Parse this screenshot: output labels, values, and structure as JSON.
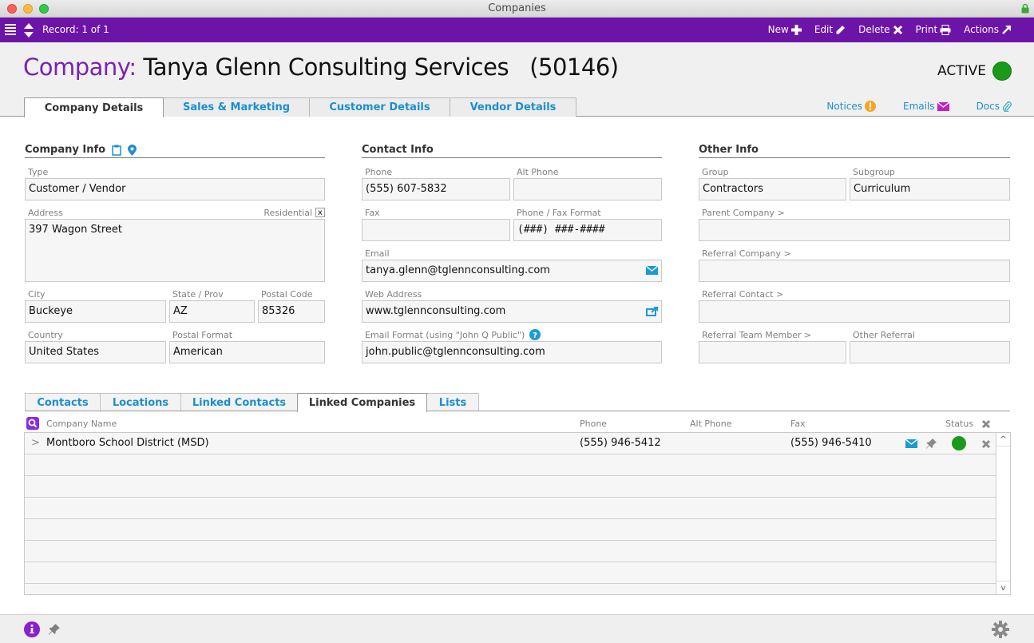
{
  "window": {
    "title": "Companies"
  },
  "toolbar": {
    "record": "Record: 1 of 1",
    "buttons": [
      {
        "label": "New",
        "icon": "plus-icon"
      },
      {
        "label": "Edit",
        "icon": "pencil-icon"
      },
      {
        "label": "Delete",
        "icon": "x-icon"
      },
      {
        "label": "Print",
        "icon": "printer-icon"
      },
      {
        "label": "Actions",
        "icon": "arrow-out-icon"
      }
    ]
  },
  "header": {
    "label": "Company:",
    "name": "Tanya Glenn Consulting Services",
    "id": "(50146)",
    "status": "ACTIVE",
    "status_color": "#1a9a1a",
    "tabs": [
      {
        "label": "Company Details",
        "active": true
      },
      {
        "label": "Sales & Marketing",
        "active": false
      },
      {
        "label": "Customer Details",
        "active": false
      },
      {
        "label": "Vendor Details",
        "active": false
      }
    ],
    "links": [
      {
        "label": "Notices",
        "icon": "alert-icon"
      },
      {
        "label": "Emails",
        "icon": "envelope-icon"
      },
      {
        "label": "Docs",
        "icon": "paperclip-icon"
      }
    ]
  },
  "company_info": {
    "title": "Company Info",
    "type": {
      "label": "Type",
      "value": "Customer / Vendor"
    },
    "address": {
      "label": "Address",
      "value": "397 Wagon Street",
      "residential_label": "Residential",
      "residential_mark": "x"
    },
    "city": {
      "label": "City",
      "value": "Buckeye"
    },
    "state": {
      "label": "State / Prov",
      "value": "AZ"
    },
    "postal": {
      "label": "Postal Code",
      "value": "85326"
    },
    "country": {
      "label": "Country",
      "value": "United States"
    },
    "postal_format": {
      "label": "Postal Format",
      "value": "American"
    }
  },
  "contact_info": {
    "title": "Contact Info",
    "phone": {
      "label": "Phone",
      "value": "(555) 607-5832"
    },
    "alt_phone": {
      "label": "Alt Phone",
      "value": ""
    },
    "fax": {
      "label": "Fax",
      "value": ""
    },
    "phone_format": {
      "label": "Phone / Fax Format",
      "value": "(###) ###-####"
    },
    "email": {
      "label": "Email",
      "value": "tanya.glenn@tglennconsulting.com"
    },
    "web": {
      "label": "Web Address",
      "value": "www.tglennconsulting.com"
    },
    "email_format": {
      "label": "Email Format (using \"John Q Public\")",
      "value": "john.public@tglennconsulting.com"
    }
  },
  "other_info": {
    "title": "Other Info",
    "group": {
      "label": "Group",
      "value": "Contractors"
    },
    "subgroup": {
      "label": "Subgroup",
      "value": "Curriculum"
    },
    "parent_company": {
      "label": "Parent Company >",
      "value": ""
    },
    "referral_company": {
      "label": "Referral Company >",
      "value": ""
    },
    "referral_contact": {
      "label": "Referral Contact >",
      "value": ""
    },
    "referral_team_member": {
      "label": "Referral Team Member >",
      "value": ""
    },
    "other_referral": {
      "label": "Other Referral",
      "value": ""
    }
  },
  "bottom_tabs": [
    {
      "label": "Contacts",
      "active": false
    },
    {
      "label": "Locations",
      "active": false
    },
    {
      "label": "Linked Contacts",
      "active": false
    },
    {
      "label": "Linked Companies",
      "active": true
    },
    {
      "label": "Lists",
      "active": false
    }
  ],
  "linked_companies": {
    "columns": {
      "name": "Company Name",
      "phone": "Phone",
      "alt_phone": "Alt Phone",
      "fax": "Fax",
      "status": "Status"
    },
    "rows": [
      {
        "expander": ">",
        "name": "Montboro School District  (MSD)",
        "phone": "(555) 946-5412",
        "alt_phone": "",
        "fax": "(555) 946-5410",
        "status_color": "#1a9a1a"
      }
    ],
    "scroll_up": "^",
    "scroll_down": "v"
  }
}
